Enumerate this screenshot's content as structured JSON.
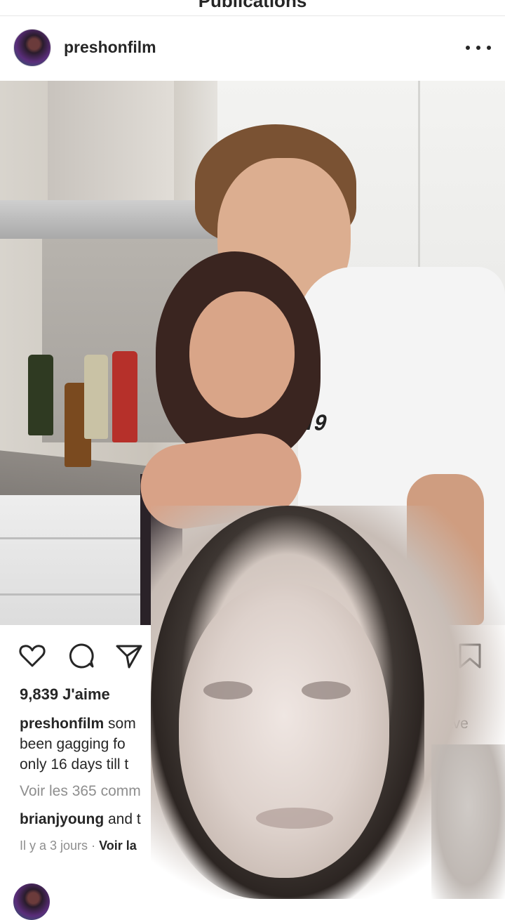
{
  "topbar": {
    "title": "Publications"
  },
  "post": {
    "username": "preshonfilm",
    "likes": "9,839 J'aime",
    "caption": {
      "user": "preshonfilm",
      "line1_start": "som",
      "line1_end": "ave",
      "line2": "been gagging fo",
      "line3": "only 16 days till t"
    },
    "comments_link": "Voir les 365 comm",
    "liked_by": {
      "user": "brianjyoung",
      "rest": " and t"
    },
    "time": "Il y a 3 jours",
    "translation": "Voir la"
  },
  "icons": {
    "more": "more-dots-icon",
    "like": "heart-icon",
    "comment": "comment-icon",
    "share": "send-icon",
    "save": "bookmark-icon",
    "user_tag": "user-icon"
  },
  "colors": {
    "text": "#262626",
    "muted": "#8e8e8e",
    "border": "#e6e6e6"
  }
}
